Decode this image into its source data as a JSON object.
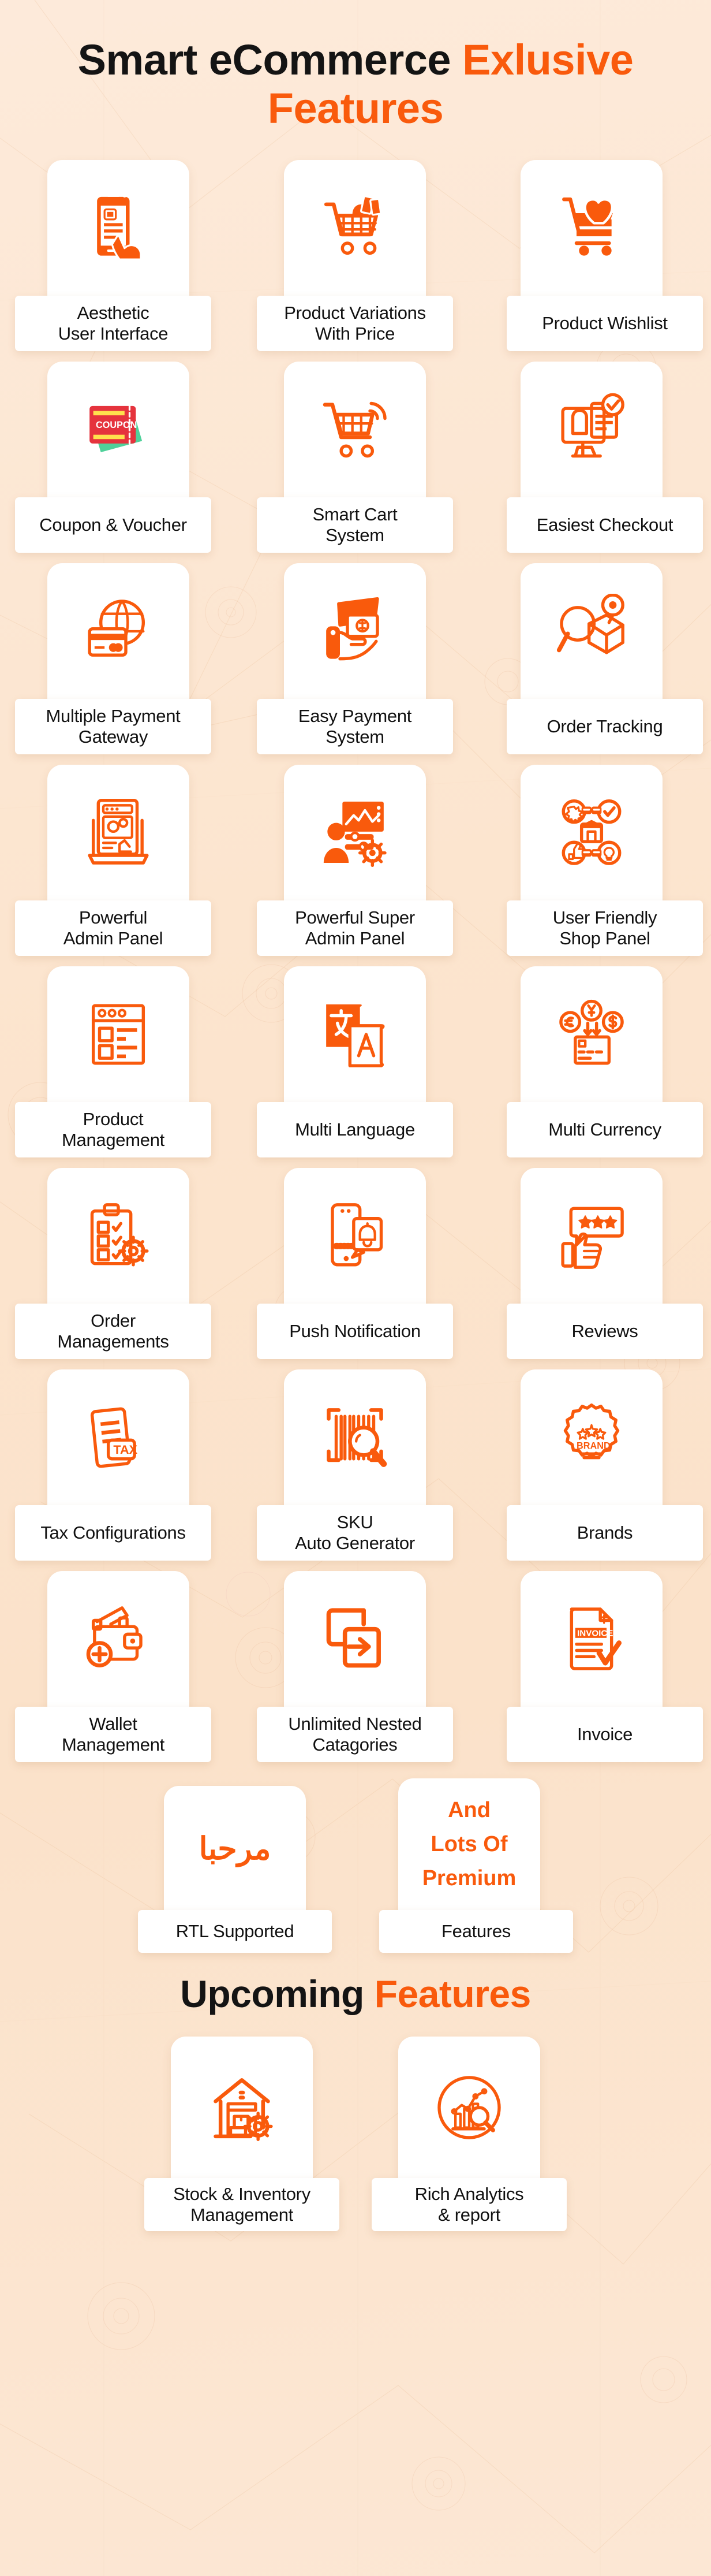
{
  "theme": {
    "accent": "#f95a0c",
    "text": "#111111",
    "card_bg": "#ffffff",
    "bg_top": "#fdeada",
    "bg_bottom": "#fce7d4"
  },
  "header": {
    "title_plain": "Smart eCommerce ",
    "title_accent": "Exlusive Features"
  },
  "upcoming_header": {
    "title_plain": "Upcoming ",
    "title_accent": "Features"
  },
  "features": [
    {
      "label": "Aesthetic\nUser Interface",
      "icon": "mobile-tap-icon"
    },
    {
      "label": "Product Variations\nWith Price",
      "icon": "shopping-cart-products-icon"
    },
    {
      "label": "Product Wishlist",
      "icon": "cart-heart-icon"
    },
    {
      "label": "Coupon & Voucher",
      "icon": "coupon-ticket-icon"
    },
    {
      "label": "Smart Cart\nSystem",
      "icon": "smart-cart-wifi-icon"
    },
    {
      "label": "Easiest Checkout",
      "icon": "monitor-checkout-check-icon"
    },
    {
      "label": "Multiple Payment\nGateway",
      "icon": "globe-credit-card-icon"
    },
    {
      "label": "Easy Payment\nSystem",
      "icon": "hand-money-wallet-icon"
    },
    {
      "label": "Order Tracking",
      "icon": "magnifier-parcel-pin-icon"
    },
    {
      "label": "Powerful\nAdmin Panel",
      "icon": "laptop-gears-dashboard-icon"
    },
    {
      "label": "Powerful Super\nAdmin Panel",
      "icon": "person-chart-gear-icon"
    },
    {
      "label": "User Friendly\nShop Panel",
      "icon": "shop-panel-network-icon"
    },
    {
      "label": "Product\nManagement",
      "icon": "product-list-window-icon"
    },
    {
      "label": "Multi Language",
      "icon": "translate-language-icon"
    },
    {
      "label": "Multi Currency",
      "icon": "multi-currency-coins-icon"
    },
    {
      "label": "Order\nManagements",
      "icon": "clipboard-checklist-gear-icon"
    },
    {
      "label": "Push Notification",
      "icon": "phone-bell-notification-icon"
    },
    {
      "label": "Reviews",
      "icon": "thumbs-up-stars-icon"
    },
    {
      "label": "Tax Configurations",
      "icon": "tax-document-icon"
    },
    {
      "label": "SKU\nAuto Generator",
      "icon": "barcode-scan-magnifier-icon"
    },
    {
      "label": "Brands",
      "icon": "brand-badge-stars-icon"
    },
    {
      "label": "Wallet\nManagement",
      "icon": "wallet-plus-icon"
    },
    {
      "label": "Unlimited Nested\nCatagories",
      "icon": "nested-arrow-boxes-icon"
    },
    {
      "label": "Invoice",
      "icon": "invoice-check-icon"
    }
  ],
  "promo": [
    {
      "label": "RTL Supported",
      "icon": "arabic-rtl-text-glyph",
      "glyph": "مرحبا"
    },
    {
      "label": "Features",
      "icon": "premium-text-block",
      "text": "And\nLots Of\nPremium"
    }
  ],
  "upcoming_features": [
    {
      "label": "Stock & Inventory\nManagement",
      "icon": "warehouse-gear-icon"
    },
    {
      "label": "Rich Analytics\n& report",
      "icon": "analytics-chart-circle-icon"
    }
  ]
}
